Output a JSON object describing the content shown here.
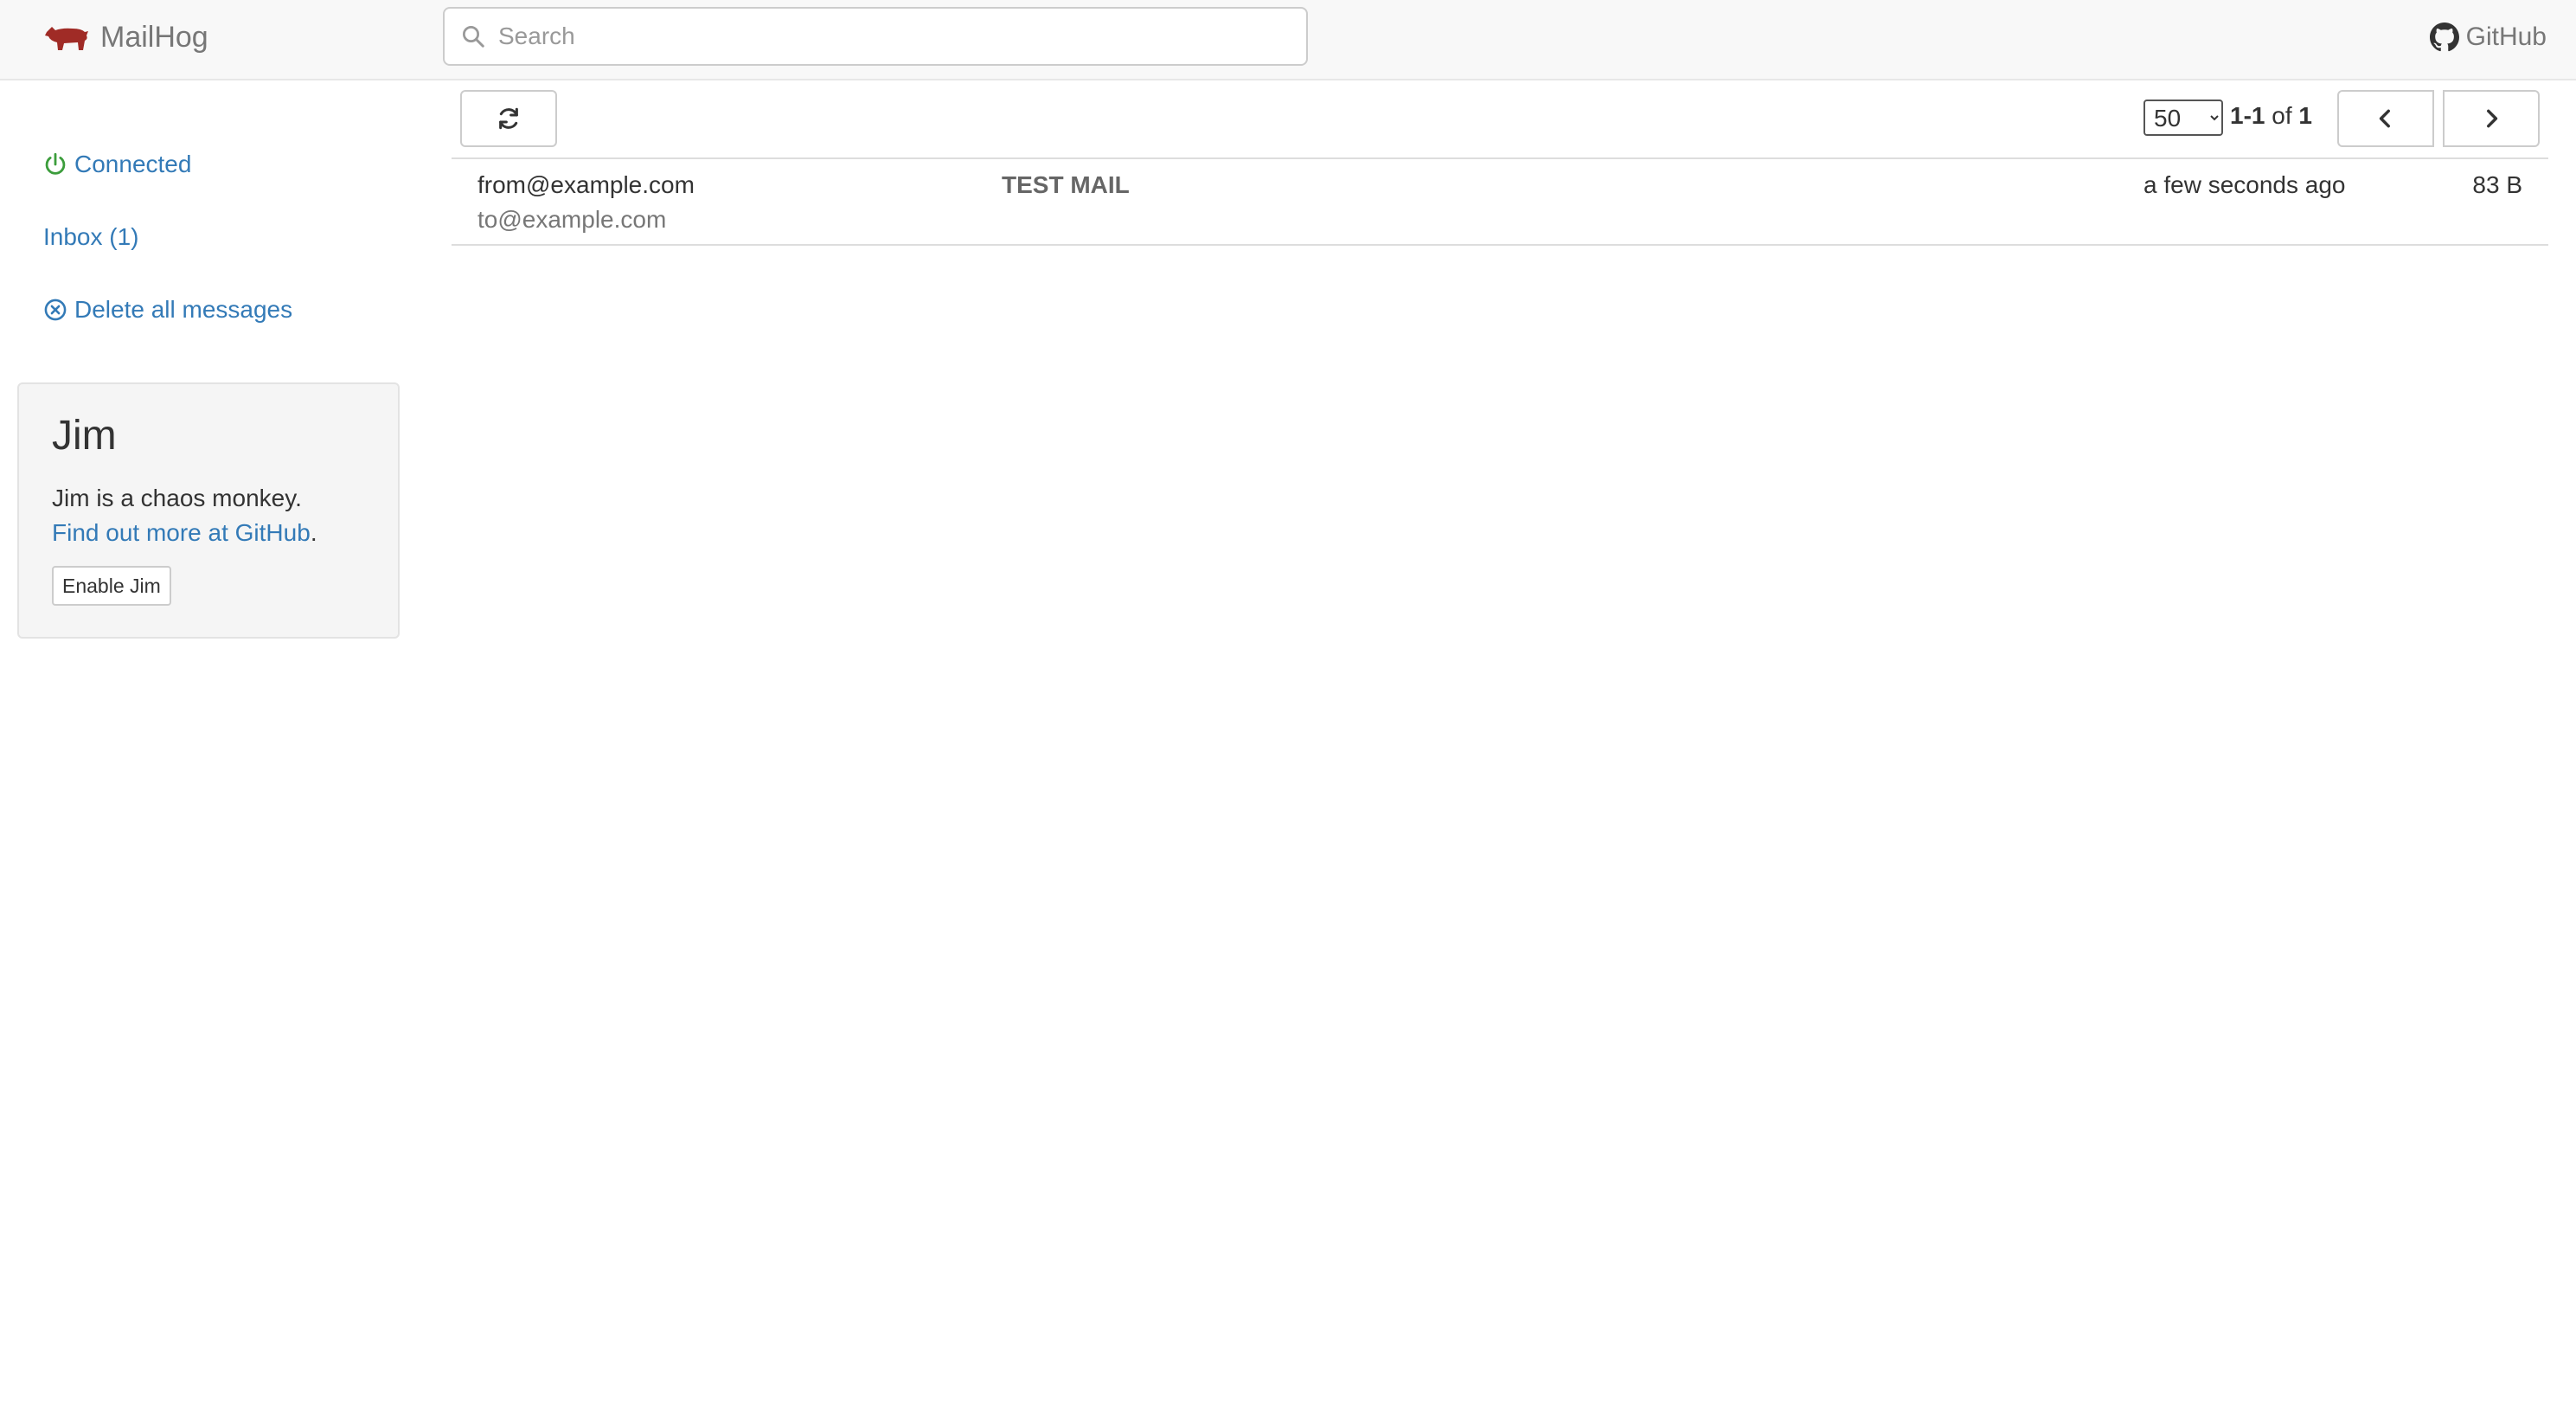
{
  "app": {
    "brand": "MailHog",
    "github_label": "GitHub"
  },
  "search": {
    "placeholder": "Search",
    "value": ""
  },
  "sidebar": {
    "connected_label": "Connected",
    "inbox_label": "Inbox (1)",
    "delete_label": "Delete all messages",
    "jim": {
      "title": "Jim",
      "description": "Jim is a chaos monkey.",
      "link_text": "Find out more at GitHub",
      "link_suffix": ".",
      "button_label": "Enable Jim"
    }
  },
  "toolbar": {
    "page_size": "50",
    "range": "1-1",
    "of_label": "of",
    "total": "1"
  },
  "messages": [
    {
      "from": "from@example.com",
      "to": "to@example.com",
      "subject": "TEST MAIL",
      "time": "a few seconds ago",
      "size": "83 B"
    }
  ],
  "icons": {
    "logo": "pig-logo-icon",
    "search": "search-icon",
    "github": "github-icon",
    "connected": "power-icon",
    "delete": "circle-x-icon",
    "refresh": "refresh-icon",
    "prev": "chevron-left-icon",
    "next": "chevron-right-icon"
  },
  "colors": {
    "link": "#337ab7",
    "connected": "#3c763d",
    "logo": "#a02b26",
    "navbar_bg": "#f8f8f8"
  }
}
